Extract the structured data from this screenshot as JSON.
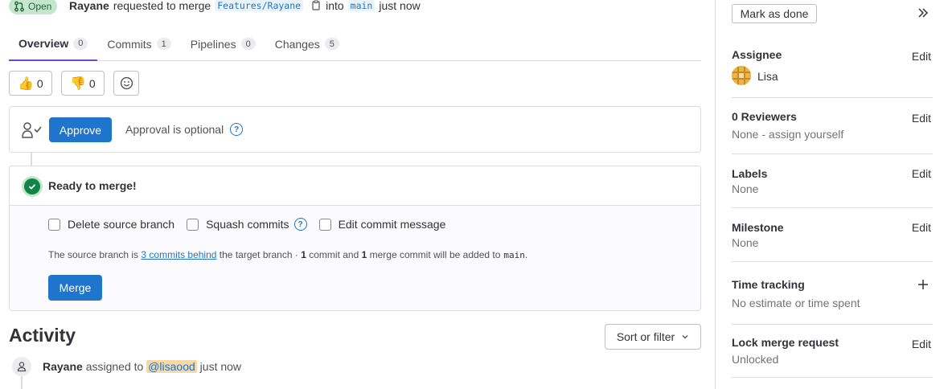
{
  "header": {
    "status": "Open",
    "author": "Rayane",
    "action": "requested to merge",
    "source_branch": "Features/Rayane",
    "into_text": "into",
    "target_branch": "main",
    "time": "just now"
  },
  "tabs": [
    {
      "label": "Overview",
      "count": "0"
    },
    {
      "label": "Commits",
      "count": "1"
    },
    {
      "label": "Pipelines",
      "count": "0"
    },
    {
      "label": "Changes",
      "count": "5"
    }
  ],
  "awards": {
    "thumbs_up": "0",
    "thumbs_down": "0"
  },
  "approval": {
    "button": "Approve",
    "text": "Approval is optional",
    "help": "?"
  },
  "merge": {
    "status": "Ready to merge!",
    "options": [
      "Delete source branch",
      "Squash commits",
      "Edit commit message"
    ],
    "help": "?",
    "note_prefix": "The source branch is",
    "note_link": "3 commits behind",
    "note_mid1": "the target branch ·",
    "note_commit_count": "1",
    "note_mid2": "commit and",
    "note_merge_count": "1",
    "note_mid3": "merge commit will be added to",
    "note_branch": "main",
    "note_end": ".",
    "button": "Merge"
  },
  "activity": {
    "title": "Activity",
    "sort_label": "Sort or filter",
    "entry_author": "Rayane",
    "entry_action": "assigned to",
    "entry_mention": "@lisaood",
    "entry_time": "just now"
  },
  "sidebar": {
    "mark_done": "Mark as done",
    "edit_label": "Edit",
    "assignee": {
      "title": "Assignee",
      "value": "Lisa"
    },
    "reviewers": {
      "title": "0 Reviewers",
      "value": "None - assign yourself"
    },
    "labels": {
      "title": "Labels",
      "value": "None"
    },
    "milestone": {
      "title": "Milestone",
      "value": "None"
    },
    "time_tracking": {
      "title": "Time tracking",
      "value": "No estimate or time spent"
    },
    "lock": {
      "title": "Lock merge request",
      "value": "Unlocked"
    }
  },
  "colors": {
    "primary": "#1f75cb",
    "success": "#108548",
    "tab_active": "#6e49cb",
    "status_bg": "#c3e6cd"
  }
}
